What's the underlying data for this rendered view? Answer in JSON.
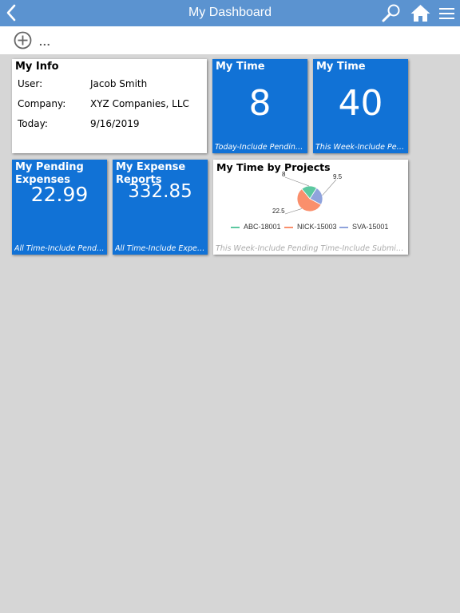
{
  "header": {
    "title": "My Dashboard"
  },
  "toolbar": {
    "more_label": "..."
  },
  "my_info": {
    "title": "My Info",
    "rows": [
      {
        "label": "User:",
        "value": "Jacob Smith"
      },
      {
        "label": "Company:",
        "value": "XYZ Companies, LLC"
      },
      {
        "label": "Today:",
        "value": "9/16/2019"
      }
    ]
  },
  "my_time_today": {
    "title": "My Time",
    "value": "8",
    "footer": "Today-Include Pending Time-Include Submitted Time"
  },
  "my_time_week": {
    "title": "My Time",
    "value": "40",
    "footer": "This Week-Include Pending Time-Include Submitted Time"
  },
  "pending_expenses": {
    "title": "My Pending Expenses",
    "value": "22.99",
    "footer": "All Time-Include Pending Expenses"
  },
  "expense_reports": {
    "title": "My Expense Reports",
    "value": "332.85",
    "footer": "All Time-Include Expense Reports"
  },
  "time_by_projects": {
    "title": "My Time by Projects",
    "footer": "This Week-Include Pending Time-Include Submitted Time",
    "chart_data": {
      "type": "pie",
      "categories": [
        "ABC-18001",
        "NICK-15003",
        "SVA-15001"
      ],
      "values": [
        8,
        22.5,
        9.5
      ],
      "labels": [
        "8",
        "22.5",
        "9.5"
      ],
      "colors": [
        "#5cc8a0",
        "#fa8f6c",
        "#8fa3dc"
      ],
      "legend": "bottom"
    }
  },
  "colors": {
    "navbar": "#5b93d0",
    "tile_blue": "#1172d6",
    "background": "#d6d6d6"
  }
}
